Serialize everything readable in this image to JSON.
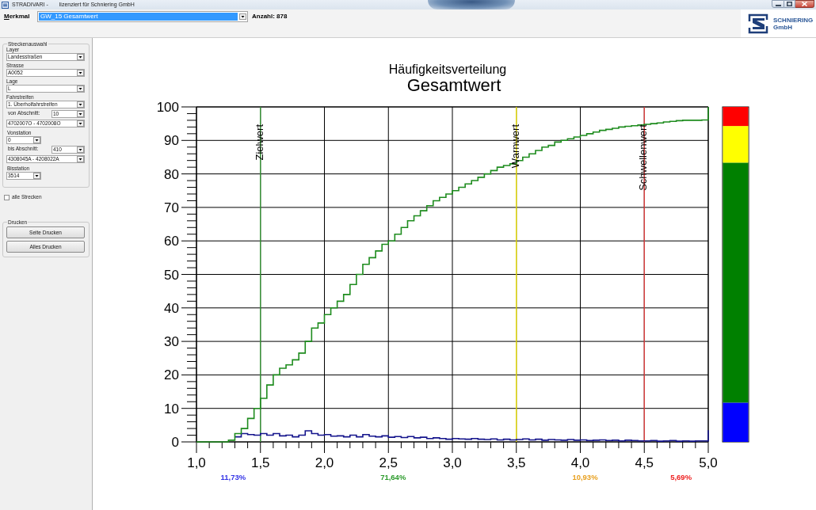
{
  "window": {
    "title": "STRADIVARI -",
    "license": "lizenziert für Schniering GmbH"
  },
  "toolbar": {
    "feature_label": "Merkmal",
    "feature_value": "GW_15 Gesamtwert",
    "count": "Anzahl: 878"
  },
  "logo": {
    "name": "SCHNIERING",
    "suffix": "GmbH"
  },
  "sidebar": {
    "route_group": {
      "title": "Streckenauswahl",
      "fields": [
        {
          "kind": "select",
          "label": "Layer",
          "value": "Landesstraßen"
        },
        {
          "kind": "select",
          "label": "Strasse",
          "value": "A0052"
        },
        {
          "kind": "select",
          "label": "Lage",
          "value": "L"
        },
        {
          "kind": "select",
          "label": "Fahrstreifen",
          "value": "1. Überholfahrstreifen"
        },
        {
          "kind": "inline",
          "label": "von Abschnitt:",
          "value": "10"
        },
        {
          "kind": "select",
          "value": "4702007O - 4702008O"
        },
        {
          "kind": "short",
          "label": "Vonstation",
          "value": "0"
        },
        {
          "kind": "inline",
          "label": "bis Abschnitt:",
          "value": "410"
        },
        {
          "kind": "select",
          "value": "4308045A - 4208022A"
        },
        {
          "kind": "short",
          "label": "Bisstation",
          "value": "3514"
        }
      ]
    },
    "all_routes": {
      "label": "alle Strecken",
      "checked": false
    },
    "print_group": {
      "title": "Drucken",
      "buttons": [
        "Seite Drucken",
        "Alles Drucken"
      ]
    }
  },
  "chart": {
    "subtitle": "Gesamtwert",
    "chart_data": {
      "type": "line",
      "title": "Häufigkeitsverteilung",
      "grid": true,
      "xlim": [
        1,
        5
      ],
      "ylim": [
        0,
        100
      ],
      "xticks": [
        {
          "value": 1,
          "label": "1,0"
        },
        {
          "value": 1.5,
          "label": "1,5"
        },
        {
          "value": 2,
          "label": "2,0"
        },
        {
          "value": 2.5,
          "label": "2,5"
        },
        {
          "value": 3,
          "label": "3,0"
        },
        {
          "value": 3.5,
          "label": "3,5"
        },
        {
          "value": 4,
          "label": "4,0"
        },
        {
          "value": 4.5,
          "label": "4,5"
        },
        {
          "value": 5,
          "label": "5,0"
        }
      ],
      "yticks": [
        0,
        10,
        20,
        30,
        40,
        50,
        60,
        70,
        80,
        90,
        100
      ],
      "x": [
        1,
        1.05,
        1.05,
        1.1,
        1.1,
        1.15,
        1.15,
        1.2,
        1.2,
        1.25,
        1.25,
        1.3,
        1.3,
        1.35,
        1.35,
        1.4,
        1.4,
        1.45,
        1.45,
        1.5,
        1.5,
        1.55,
        1.55,
        1.6,
        1.6,
        1.65,
        1.65,
        1.7,
        1.7,
        1.75,
        1.75,
        1.8,
        1.8,
        1.85,
        1.85,
        1.9,
        1.9,
        1.95,
        1.95,
        2,
        2,
        2.05,
        2.05,
        2.1,
        2.1,
        2.15,
        2.15,
        2.2,
        2.2,
        2.25,
        2.25,
        2.3,
        2.3,
        2.35,
        2.35,
        2.4,
        2.4,
        2.45,
        2.45,
        2.5,
        2.5,
        2.55,
        2.55,
        2.6,
        2.6,
        2.65,
        2.65,
        2.7,
        2.7,
        2.75,
        2.75,
        2.8,
        2.8,
        2.85,
        2.85,
        2.9,
        2.9,
        2.95,
        2.95,
        3,
        3,
        3.05,
        3.05,
        3.1,
        3.1,
        3.15,
        3.15,
        3.2,
        3.2,
        3.25,
        3.25,
        3.3,
        3.3,
        3.35,
        3.35,
        3.4,
        3.4,
        3.45,
        3.45,
        3.5,
        3.5,
        3.55,
        3.55,
        3.6,
        3.6,
        3.65,
        3.65,
        3.7,
        3.7,
        3.75,
        3.75,
        3.8,
        3.8,
        3.85,
        3.85,
        3.9,
        3.9,
        3.95,
        3.95,
        4,
        4,
        4.05,
        4.05,
        4.1,
        4.1,
        4.15,
        4.15,
        4.2,
        4.2,
        4.25,
        4.25,
        4.3,
        4.3,
        4.35,
        4.35,
        4.4,
        4.4,
        4.45,
        4.45,
        4.5,
        4.5,
        4.55,
        4.55,
        4.6,
        4.6,
        4.65,
        4.65,
        4.7,
        4.7,
        4.75,
        4.75,
        4.8,
        4.8,
        4.85,
        4.85,
        4.9,
        4.9,
        4.95,
        4.95,
        5,
        5
      ],
      "series": [
        {
          "color": "#14148c",
          "values": [
            null,
            null,
            null,
            null,
            null,
            null,
            null,
            null,
            null,
            null,
            null,
            null,
            1.5,
            1.5,
            2.5,
            2.5,
            2.2,
            2.2,
            2,
            2,
            2.5,
            2.5,
            2,
            2,
            2.5,
            2.5,
            1.8,
            1.8,
            2,
            2,
            1.5,
            1.5,
            2,
            2,
            3.3,
            3.3,
            2.5,
            2.5,
            2,
            2,
            2.2,
            2.2,
            1.7,
            1.7,
            1.8,
            1.8,
            1.5,
            1.5,
            2,
            2,
            1.5,
            1.5,
            2.2,
            2.2,
            1.7,
            1.7,
            1.5,
            1.5,
            1.8,
            1.8,
            1.4,
            1.4,
            1.6,
            1.6,
            1.3,
            1.3,
            1.6,
            1.6,
            1.2,
            1.2,
            1.4,
            1.4,
            1,
            1,
            1.2,
            1.2,
            1,
            1,
            0.8,
            0.8,
            1,
            1,
            0.9,
            0.9,
            0.8,
            0.8,
            1,
            1,
            0.8,
            0.8,
            0.7,
            0.7,
            0.9,
            0.9,
            0.6,
            0.6,
            0.8,
            0.8,
            0.6,
            0.6,
            0.7,
            0.7,
            0.9,
            0.9,
            0.6,
            0.6,
            0.8,
            0.8,
            0.5,
            0.5,
            0.7,
            0.7,
            0.6,
            0.6,
            0.5,
            0.5,
            0.7,
            0.7,
            0.5,
            0.5,
            0.6,
            0.6,
            0.4,
            0.4,
            0.5,
            0.5,
            0.6,
            0.6,
            0.4,
            0.4,
            0.5,
            0.5,
            0.3,
            0.3,
            0.5,
            0.5,
            0.4,
            0.4,
            0.3,
            0.3,
            0.3,
            0.3,
            0.4,
            0.4,
            0.2,
            0.2,
            0.3,
            0.3,
            0.4,
            0.4,
            0.2,
            0.2,
            0.3,
            0.3,
            0.2,
            0.2,
            0.3,
            0.3,
            0.3,
            0.3,
            3.5
          ]
        },
        {
          "color": "#1e8c1e",
          "values": [
            0,
            0,
            0,
            0,
            0,
            0,
            0,
            0,
            0,
            0,
            0.5,
            0.5,
            2.5,
            2.5,
            4,
            4,
            7,
            7,
            10,
            10,
            13,
            13,
            17,
            17,
            20,
            20,
            22,
            22,
            23,
            23,
            24.5,
            24.5,
            26.5,
            26.5,
            30,
            30,
            34,
            34,
            35.5,
            35.5,
            38,
            38,
            40,
            40,
            42,
            42,
            44,
            44,
            47,
            47,
            50,
            50,
            53,
            53,
            55,
            55,
            57,
            57,
            59,
            59,
            60,
            60,
            62,
            62,
            64,
            64,
            66,
            66,
            67.5,
            67.5,
            69,
            69,
            70.5,
            70.5,
            72,
            72,
            73,
            73,
            74,
            74,
            75,
            75,
            76,
            76,
            77,
            77,
            78,
            78,
            79,
            79,
            80,
            80,
            81,
            81,
            82,
            82,
            82.5,
            82.5,
            83,
            83,
            84,
            84,
            85,
            85,
            86,
            86,
            87,
            87,
            88,
            88,
            88.5,
            88.5,
            89.5,
            89.5,
            90,
            90,
            90.5,
            90.5,
            91,
            91,
            91.5,
            91.5,
            92,
            92,
            92.5,
            92.5,
            93,
            93,
            93.3,
            93.3,
            93.6,
            93.6,
            94,
            94,
            94.2,
            94.2,
            94.4,
            94.4,
            94.6,
            94.6,
            94.8,
            94.8,
            95,
            95,
            95.2,
            95.2,
            95.5,
            95.5,
            95.7,
            95.7,
            95.9,
            95.9,
            96,
            96,
            96,
            96,
            96,
            96,
            96.1,
            96.1,
            100
          ]
        }
      ],
      "ref_lines": [
        {
          "axis": "x",
          "value": 1.5,
          "label": "Zielwert",
          "color": "#3aa03a"
        },
        {
          "axis": "x",
          "value": 3.5,
          "label": "Warnwert",
          "color": "#f5ec00"
        },
        {
          "axis": "x",
          "value": 4.5,
          "label": "Schwellenwert",
          "color": "#e84040"
        }
      ]
    },
    "zone_labels": [
      {
        "label": "11,73%",
        "color": "#3333e6"
      },
      {
        "label": "71,64%",
        "color": "#2a9a2a"
      },
      {
        "label": "10,93%",
        "color": "#e8a020"
      },
      {
        "label": "5,69%",
        "color": "#ee2222"
      }
    ],
    "color_scale": [
      {
        "color": "#0000ff"
      },
      {
        "color": "#008000"
      },
      {
        "color": "#ffff00"
      },
      {
        "color": "#ff0000"
      }
    ]
  }
}
